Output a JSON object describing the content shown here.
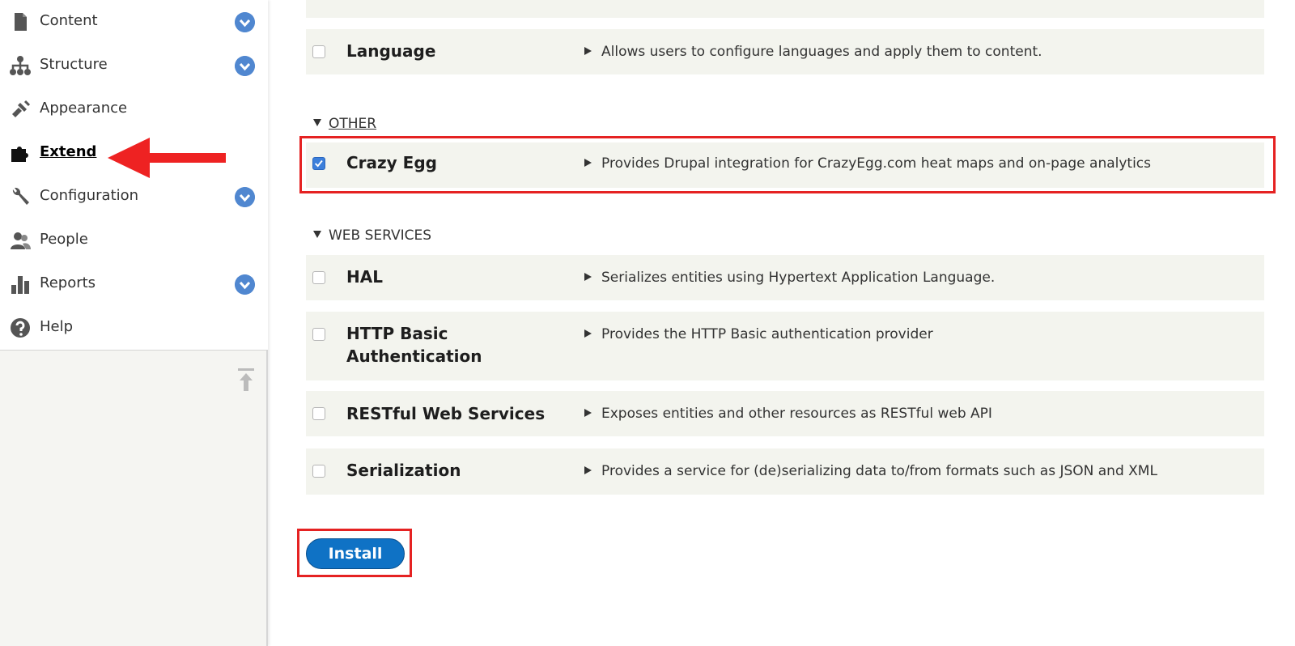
{
  "sidebar": {
    "items": [
      {
        "label": "Content",
        "icon": "file-icon",
        "expandable": true
      },
      {
        "label": "Structure",
        "icon": "sitemap-icon",
        "expandable": true
      },
      {
        "label": "Appearance",
        "icon": "paintbrush-icon",
        "expandable": false
      },
      {
        "label": "Extend",
        "icon": "puzzle-icon",
        "expandable": false,
        "active": true
      },
      {
        "label": "Configuration",
        "icon": "wrench-icon",
        "expandable": true
      },
      {
        "label": "People",
        "icon": "people-icon",
        "expandable": false
      },
      {
        "label": "Reports",
        "icon": "bar-chart-icon",
        "expandable": true
      },
      {
        "label": "Help",
        "icon": "help-icon",
        "expandable": false
      }
    ]
  },
  "modules": {
    "language": {
      "name": "Language",
      "checked": false,
      "description": "Allows users to configure languages and apply them to content."
    },
    "other_section": "OTHER",
    "crazy_egg": {
      "name": "Crazy Egg",
      "checked": true,
      "description": "Provides Drupal integration for CrazyEgg.com heat maps and on-page analytics"
    },
    "web_services_section": "WEB SERVICES",
    "hal": {
      "name": "HAL",
      "checked": false,
      "description": "Serializes entities using Hypertext Application Language."
    },
    "http_basic": {
      "name_line1": "HTTP Basic",
      "name_line2": "Authentication",
      "checked": false,
      "description": "Provides the HTTP Basic authentication provider"
    },
    "restful": {
      "name": "RESTful Web Services",
      "checked": false,
      "description": "Exposes entities and other resources as RESTful web API"
    },
    "serialization": {
      "name": "Serialization",
      "checked": false,
      "description": "Provides a service for (de)serializing data to/from formats such as JSON and XML"
    }
  },
  "actions": {
    "install_label": "Install"
  },
  "colors": {
    "accent": "#0f72c5",
    "highlight": "#e52222",
    "expand_button": "#5087d0",
    "row_bg": "#f3f4ee"
  }
}
